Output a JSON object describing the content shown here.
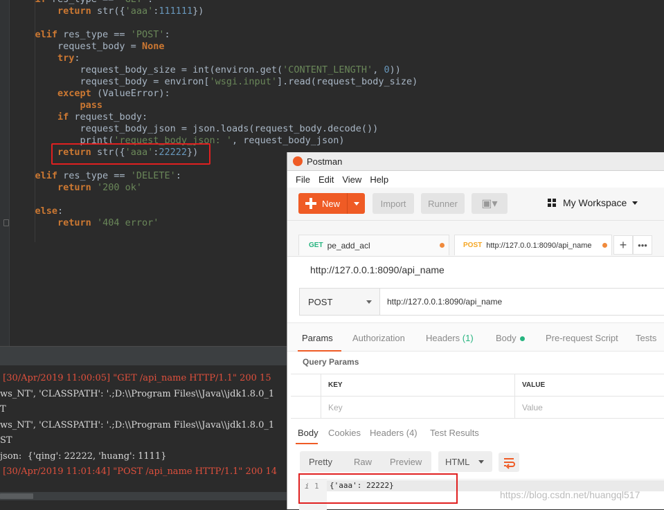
{
  "editor": {
    "lines": [
      [
        {
          "c": "kw",
          "t": "if "
        },
        {
          "c": "",
          "t": "res_type == "
        },
        {
          "c": "str",
          "t": "'GET'"
        },
        {
          "c": "",
          "t": ":"
        }
      ],
      [
        {
          "c": "",
          "t": "    "
        },
        {
          "c": "kw",
          "t": "return "
        },
        {
          "c": "",
          "t": "str({"
        },
        {
          "c": "str",
          "t": "'aaa'"
        },
        {
          "c": "",
          "t": ":"
        },
        {
          "c": "num",
          "t": "111111"
        },
        {
          "c": "",
          "t": "})"
        }
      ],
      [
        {
          "c": "",
          "t": ""
        }
      ],
      [
        {
          "c": "kw",
          "t": "elif "
        },
        {
          "c": "",
          "t": "res_type == "
        },
        {
          "c": "str",
          "t": "'POST'"
        },
        {
          "c": "",
          "t": ":"
        }
      ],
      [
        {
          "c": "",
          "t": "    request_body = "
        },
        {
          "c": "none",
          "t": "None"
        }
      ],
      [
        {
          "c": "",
          "t": "    "
        },
        {
          "c": "kw",
          "t": "try"
        },
        {
          "c": "",
          "t": ":"
        }
      ],
      [
        {
          "c": "",
          "t": "        request_body_size = int(environ.get("
        },
        {
          "c": "str",
          "t": "'CONTENT_LENGTH'"
        },
        {
          "c": "",
          "t": ", "
        },
        {
          "c": "num",
          "t": "0"
        },
        {
          "c": "",
          "t": "))"
        }
      ],
      [
        {
          "c": "",
          "t": "        request_body = environ["
        },
        {
          "c": "str",
          "t": "'wsgi.input'"
        },
        {
          "c": "",
          "t": "].read(request_body_size)"
        }
      ],
      [
        {
          "c": "",
          "t": "    "
        },
        {
          "c": "kw",
          "t": "except "
        },
        {
          "c": "",
          "t": "(ValueError):"
        }
      ],
      [
        {
          "c": "",
          "t": "        "
        },
        {
          "c": "kw",
          "t": "pass"
        }
      ],
      [
        {
          "c": "",
          "t": "    "
        },
        {
          "c": "kw",
          "t": "if "
        },
        {
          "c": "",
          "t": "request_body:"
        }
      ],
      [
        {
          "c": "",
          "t": "        request_body_json = json.loads(request_body.decode())"
        }
      ],
      [
        {
          "c": "",
          "t": "        print("
        },
        {
          "c": "str",
          "t": "'request_body_json: '"
        },
        {
          "c": "",
          "t": ", request_body_json)"
        }
      ],
      [
        {
          "c": "",
          "t": "    "
        },
        {
          "c": "kw",
          "t": "return "
        },
        {
          "c": "",
          "t": "str({"
        },
        {
          "c": "str",
          "t": "'aaa'"
        },
        {
          "c": "",
          "t": ":"
        },
        {
          "c": "num",
          "t": "22222"
        },
        {
          "c": "",
          "t": "})"
        }
      ],
      [
        {
          "c": "",
          "t": ""
        }
      ],
      [
        {
          "c": "kw",
          "t": "elif "
        },
        {
          "c": "",
          "t": "res_type == "
        },
        {
          "c": "str",
          "t": "'DELETE'"
        },
        {
          "c": "",
          "t": ":"
        }
      ],
      [
        {
          "c": "",
          "t": "    "
        },
        {
          "c": "kw",
          "t": "return "
        },
        {
          "c": "str",
          "t": "'200 ok'"
        }
      ],
      [
        {
          "c": "",
          "t": ""
        }
      ],
      [
        {
          "c": "kw",
          "t": "else"
        },
        {
          "c": "",
          "t": ":"
        }
      ],
      [
        {
          "c": "",
          "t": "    "
        },
        {
          "c": "kw",
          "t": "return "
        },
        {
          "c": "str",
          "t": "'404 error'"
        }
      ]
    ]
  },
  "console": {
    "lines": [
      {
        "text": " [30/Apr/2019 11:00:05] \"GET /api_name HTTP/1.1\" 200 15",
        "red": true
      },
      {
        "text": "ws_NT', 'CLASSPATH': '.;D:\\\\Program Files\\\\Java\\\\jdk1.8.0_1",
        "red": false
      },
      {
        "text": "T",
        "red": false
      },
      {
        "text": "ws_NT', 'CLASSPATH': '.;D:\\\\Program Files\\\\Java\\\\jdk1.8.0_1",
        "red": false
      },
      {
        "text": "ST",
        "red": false
      },
      {
        "text": "json:  {'qing': 22222, 'huang': 1111}",
        "red": false
      },
      {
        "text": " [30/Apr/2019 11:01:44] \"POST /api_name HTTP/1.1\" 200 14",
        "red": true
      }
    ]
  },
  "postman": {
    "title": "Postman",
    "menu": [
      "File",
      "Edit",
      "View",
      "Help"
    ],
    "toolbar": {
      "new": "New",
      "import": "Import",
      "runner": "Runner",
      "workspace": "My Workspace"
    },
    "tabs": [
      {
        "method": "GET",
        "label": "pe_add_acl",
        "method_color": "#26b47f"
      },
      {
        "method": "POST",
        "label": "http://127.0.0.1:8090/api_name",
        "method_color": "#f5a623"
      }
    ],
    "request_title": "http://127.0.0.1:8090/api_name",
    "method": "POST",
    "url": "http://127.0.0.1:8090/api_name",
    "request_tabs": {
      "params": "Params",
      "authorization": "Authorization",
      "headers": "Headers",
      "headers_count": "(1)",
      "body": "Body",
      "prerequest": "Pre-request Script",
      "tests": "Tests"
    },
    "query_params": {
      "title": "Query Params",
      "key_header": "KEY",
      "value_header": "VALUE",
      "key_placeholder": "Key",
      "value_placeholder": "Value"
    },
    "response_tabs": {
      "body": "Body",
      "cookies": "Cookies",
      "headers": "Headers (4)",
      "test_results": "Test Results"
    },
    "view": {
      "pretty": "Pretty",
      "raw": "Raw",
      "preview": "Preview",
      "format": "HTML"
    },
    "response": {
      "info": "i",
      "line_no": "1",
      "text": "{'aaa': 22222}"
    }
  },
  "watermark": "https://blog.csdn.net/huangql517",
  "colors": {
    "accent": "#ef5b25",
    "highlight_box": "#e02020",
    "get": "#26b47f",
    "post": "#f5a623"
  }
}
